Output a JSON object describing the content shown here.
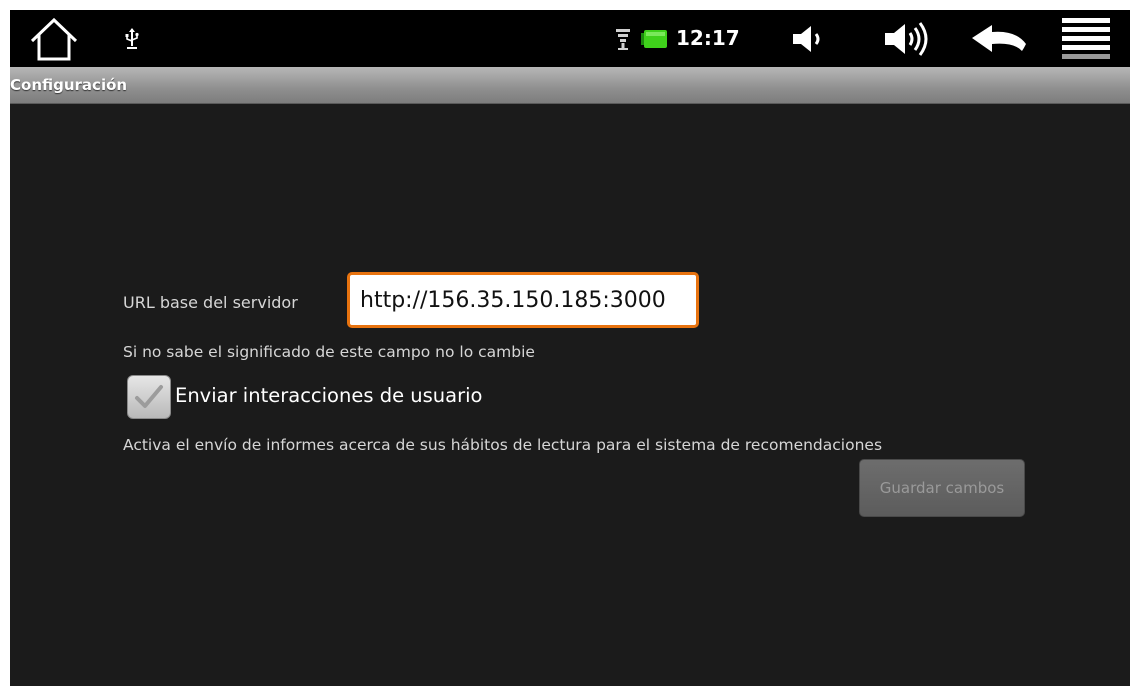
{
  "status_bar": {
    "time": "12:17",
    "icons": {
      "home": "home-icon",
      "usb": "usb-icon",
      "wifi": "wifi-icon",
      "battery": "battery-icon",
      "volume_down": "volume-down-icon",
      "volume_up": "volume-up-icon",
      "back": "back-arrow-icon",
      "menu": "menu-icon"
    },
    "battery_color": "#3fd11b"
  },
  "title_bar": {
    "title": "Configuración"
  },
  "settings": {
    "url_label": "URL base del servidor",
    "url_value": "http://156.35.150.185:3000",
    "url_help": "Si no sabe el significado de este campo no lo cambie",
    "send_interactions_label": "Enviar interacciones de usuario",
    "send_interactions_checked": true,
    "send_interactions_help": "Activa el envío de informes acerca de sus hábitos de lectura para el sistema de recomendaciones",
    "save_button_label": "Guardar cambos",
    "save_button_enabled": false
  },
  "colors": {
    "focus_border": "#e8730f",
    "background": "#1b1b1b"
  }
}
